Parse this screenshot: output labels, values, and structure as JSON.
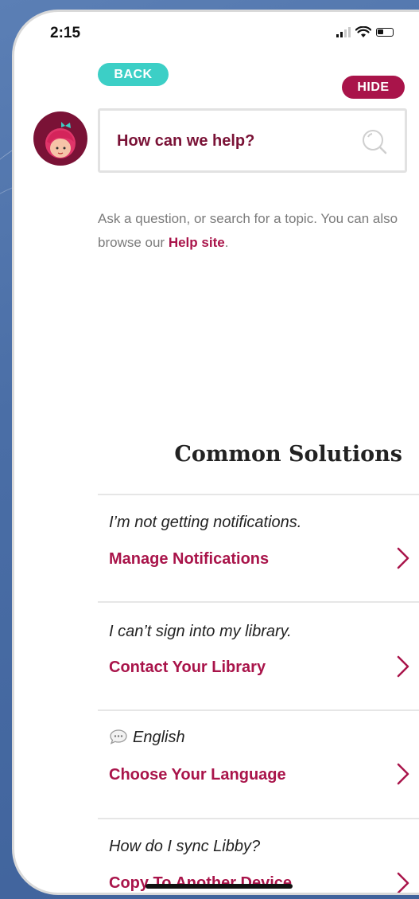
{
  "status_bar": {
    "time": "2:15"
  },
  "header": {
    "back_label": "BACK",
    "hide_label": "HIDE"
  },
  "search": {
    "placeholder": "How can we help?"
  },
  "help": {
    "text_before": "Ask a question, or search for a topic. You can also browse our ",
    "link": "Help site",
    "text_after": "."
  },
  "solutions": {
    "title": "Common Solutions",
    "items": [
      {
        "question": "I’m not getting notifications.",
        "action": "Manage Notifications"
      },
      {
        "question": "I can’t sign into my library.",
        "action": "Contact Your Library"
      },
      {
        "question": "English",
        "action": "Choose Your Language"
      },
      {
        "question": "How do I sync Libby?",
        "action": "Copy To Another Device"
      }
    ]
  },
  "colors": {
    "accent": "#a9144a",
    "back_button": "#3ccfc6",
    "avatar_bg": "#7a1236"
  }
}
